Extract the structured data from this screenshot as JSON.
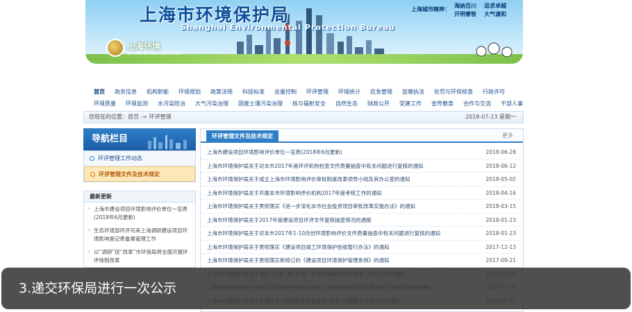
{
  "banner": {
    "title_cn": "上海市环境保护局",
    "title_en": "Shanghai Environmental Protection Bureau",
    "logo_cn": "上海环境",
    "logo_en": "SHANGHAI ENVIRONMENT",
    "spirit_label": "上海城市精神：",
    "spirit_items": [
      "海纳百川",
      "追求卓越",
      "开明睿智",
      "大气谦和"
    ]
  },
  "nav": {
    "row1": [
      "首页",
      "政务信息",
      "机构职能",
      "环境规划",
      "政策法规",
      "科技标准",
      "总量控制",
      "环评管理",
      "环境统计",
      "应急管理",
      "监察执法",
      "处罚与环保核查",
      "行政许可"
    ],
    "row2": [
      "环境质量",
      "环境监测",
      "水污染防治",
      "大气污染治理",
      "固废土壤污染治理",
      "核与辐射安全",
      "自然生态",
      "财政公开",
      "党建工作",
      "宣传教育",
      "合作与交流",
      "干部人事"
    ],
    "active": "首页"
  },
  "breadcrumb": {
    "text": "您现在的位置：首页 -> 环评管理",
    "date": "2018-07-23 星期一"
  },
  "sidebar": {
    "title": "导航栏目",
    "items": [
      {
        "label": "环评管理工作动态"
      },
      {
        "label": "环评管理文件及技术规定"
      }
    ],
    "latest_title": "最新更新",
    "latest": [
      "上海市建设项目环境影响评价单位一览表(2018年6月更新)",
      "生态环境部环评司来上海调研建设项目环境影响登记表备案管理工作",
      "以“调研”促“改革”市环保局将全面开展环评体制改革"
    ]
  },
  "main": {
    "tab_label": "环评管理文件及技术规定",
    "more_label": "更多",
    "rows": [
      {
        "title": "上海市建设项目环境影响评价单位一览表(2018年6月更新)",
        "date": "2018-06-28"
      },
      {
        "title": "上海市环境保护局关于对本市2017年度环评机构检查文件质量抽查中有关问题进行复核的通知",
        "date": "2018-06-12"
      },
      {
        "title": "上海市环境保护局关于成立上海市环境影响评价审批制度改革领导小组及其办公室的通知",
        "date": "2018-05-02"
      },
      {
        "title": "上海市环境保护局关于开展本市环境影响评价机构2017年度考核工作的通知",
        "date": "2018-04-16"
      },
      {
        "title": "上海市环境保护局关于贯彻落实《进一步深化本市社会投资项目审批改革实施办法》的通知",
        "date": "2018-03-15"
      },
      {
        "title": "上海市环境保护局关于2017年度建设项目环评文件复核抽查情况的通报",
        "date": "2018-01-23"
      },
      {
        "title": "上海市环境保护局关于对本市2017年1-10月份环境影响评价文件质量抽查中有关问题进行复核的通知",
        "date": "2018-01-23"
      },
      {
        "title": "上海市环境保护局关于贯彻落实《建设项目竣工环境保护验收暂行办法》的通知",
        "date": "2017-12-13"
      },
      {
        "title": "上海市环境保护局关于贯彻落实新修订的《建设项目环境保护管理条例》的通知",
        "date": "2017-09-21"
      },
      {
        "title": "上海市环境保护局关于落实“三线一单”约束，实施区域差别化环境准入相关工作的通知",
        "date": "2017-07-26"
      },
      {
        "title": "上海市环境保护局关于建立环境影响评价技术评估工作中的建设项目环境违法行为报告制度的通知",
        "date": "2017-07-26"
      },
      {
        "title": "上海市环境保护局关于开展环评工程师职业资格证书“挂靠”问题集中治理工作的通知",
        "date": "2017-07-10"
      }
    ]
  },
  "caption": "3.递交环保局进行一次公示"
}
